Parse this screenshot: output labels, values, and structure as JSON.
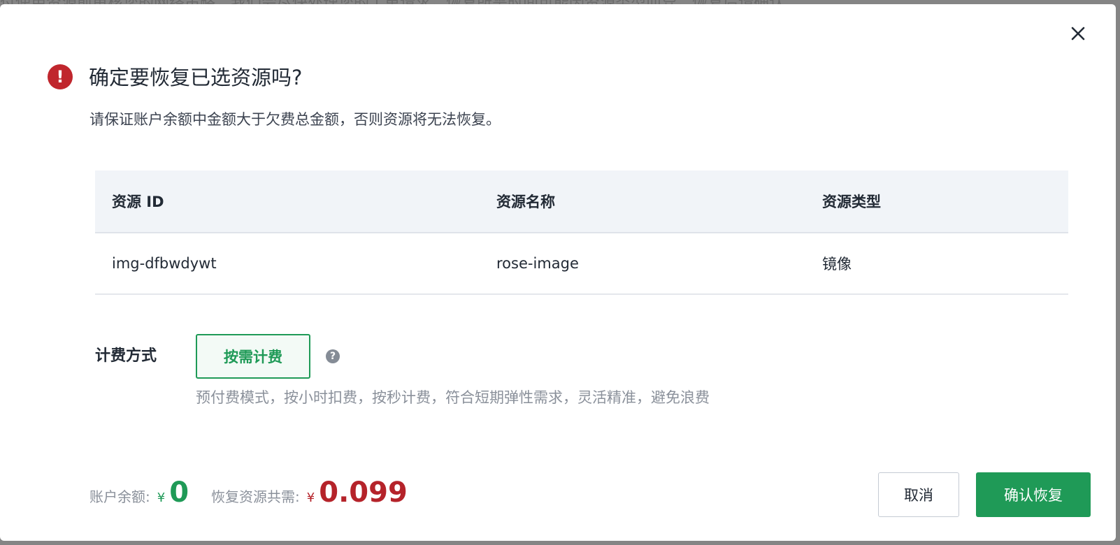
{
  "backdrop": {
    "text": "付使用资源前审核您的网络策略，我们会尽快处理您的工单请求，恢复所需时间可能因资源类型而异，恢复后请确认"
  },
  "dialog": {
    "close_icon": "close-icon",
    "alert_icon": "exclamation-icon",
    "alert_symbol": "!",
    "title": "确定要恢复已选资源吗?",
    "subtitle": "请保证账户余额中金额大于欠费总金额，否则资源将无法恢复。"
  },
  "table": {
    "columns": [
      "资源 ID",
      "资源名称",
      "资源类型"
    ],
    "rows": [
      [
        "img-dfbwdywt",
        "rose-image",
        "镜像"
      ]
    ]
  },
  "billing": {
    "label": "计费方式",
    "option": "按需计费",
    "help_symbol": "?",
    "help_icon": "question-icon",
    "description": "预付费模式，按小时扣费，按秒计费，符合短期弹性需求，灵活精准，避免浪费"
  },
  "footer": {
    "balance_label": "账户余额:",
    "balance_currency": "¥",
    "balance_amount": "0",
    "required_label": "恢复资源共需:",
    "required_currency": "¥",
    "required_amount": "0.099",
    "cancel_label": "取消",
    "confirm_label": "确认恢复"
  },
  "colors": {
    "accent": "#1f9a57",
    "danger": "#b5232a",
    "alert": "#c0262d"
  }
}
